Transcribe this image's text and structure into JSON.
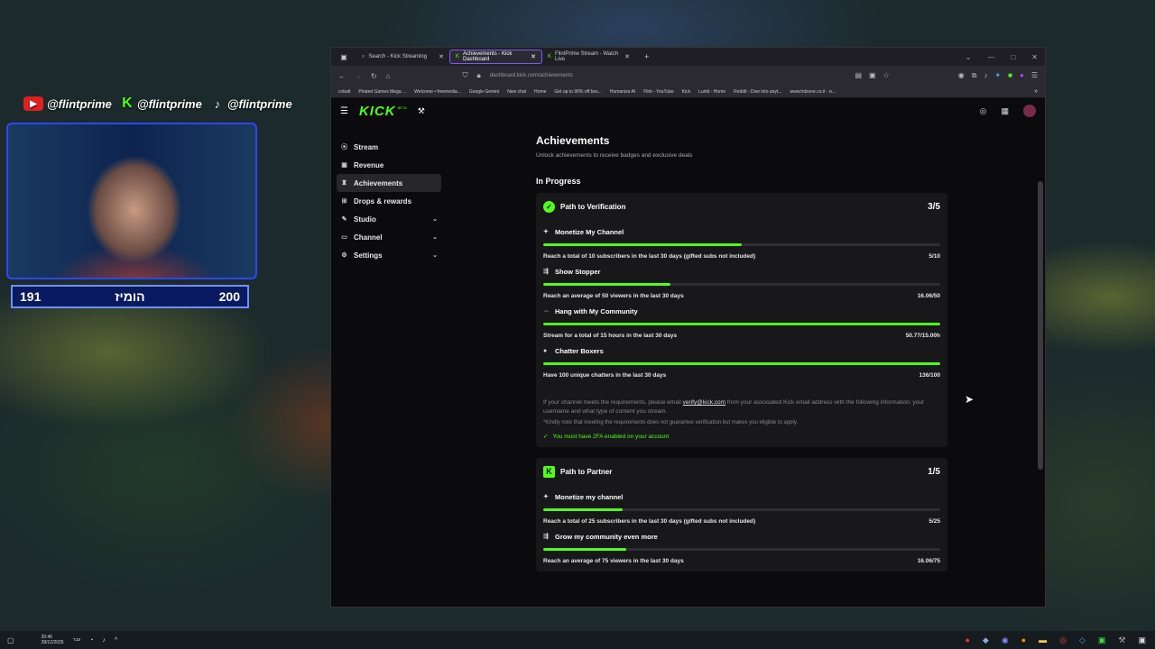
{
  "overlay": {
    "socials": [
      {
        "icon": "youtube-icon",
        "handle": "@flintprime"
      },
      {
        "icon": "kick-icon",
        "handle": "@flintprime"
      },
      {
        "icon": "tiktok-icon",
        "handle": "@flintprime"
      }
    ],
    "counter": {
      "left": "191",
      "middle": "הומיז",
      "right": "200"
    }
  },
  "browser": {
    "tabs": [
      {
        "title": "Search - Kick Streaming",
        "active": false
      },
      {
        "title": "Achievements - Kick Dashboard",
        "active": true
      },
      {
        "title": "FlintPrime Stream - Watch Live",
        "active": false
      }
    ],
    "url": "dashboard.kick.com/achievements",
    "bookmarks": [
      "cobalt",
      "Pirated Games Mega ...",
      "Welcome • freemedia...",
      "Google Gemini",
      "New chat",
      "Home",
      "Get up to 90% off bes...",
      "Humanize AI",
      "Flint - YouTube",
      "Kick",
      "Lurkit - Home",
      "Reddit - Dive into anyt...",
      "www.hdzone.co.il - ס..."
    ]
  },
  "app": {
    "logo": "KICK",
    "beta": "BETA",
    "sidebar": [
      {
        "label": "Stream",
        "icon": "broadcast-icon",
        "active": false,
        "chevron": false
      },
      {
        "label": "Revenue",
        "icon": "revenue-icon",
        "active": false,
        "chevron": false
      },
      {
        "label": "Achievements",
        "icon": "trophy-icon",
        "active": true,
        "chevron": false
      },
      {
        "label": "Drops & rewards",
        "icon": "gift-icon",
        "active": false,
        "chevron": false
      },
      {
        "label": "Studio",
        "icon": "studio-icon",
        "active": false,
        "chevron": true
      },
      {
        "label": "Channel",
        "icon": "channel-icon",
        "active": false,
        "chevron": true
      },
      {
        "label": "Settings",
        "icon": "gear-icon",
        "active": false,
        "chevron": true
      }
    ],
    "page_title": "Achievements",
    "page_subtitle": "Unlock achievements to receive badges and exclusive deals",
    "section_title": "In Progress",
    "verification": {
      "title": "Path to Verification",
      "score": "3/5",
      "items": [
        {
          "name": "Monetize My Channel",
          "icon": "sparkle-icon",
          "desc": "Reach a total of 10 subscribers in the last 30 days (gifted subs not included)",
          "value": "5/10",
          "progress": 0.5
        },
        {
          "name": "Show Stopper",
          "icon": "viewers-icon",
          "desc": "Reach an average of 50 viewers in the last 30 days",
          "value": "16.06/50",
          "progress": 0.32
        },
        {
          "name": "Hang with My Community",
          "icon": "community-icon",
          "desc": "Stream for a total of 15 hours in the last 30 days",
          "value": "50.77/15.00h",
          "progress": 1.0
        },
        {
          "name": "Chatter Boxers",
          "icon": "chat-icon",
          "desc": "Have 100 unique chatters in the last 30 days",
          "value": "136/100",
          "progress": 1.0
        }
      ],
      "note_prefix": "If your channel meets the requirements, please email ",
      "note_email": "verify@kick.com",
      "note_suffix": " from your associated Kick email address with the following information: your username and what type of content you stream.",
      "note2": "*Kindly note that meeting the requirements does not guarantee verification but makes you eligible to apply.",
      "twofa": "You must have 2FA enabled on your account"
    },
    "partner": {
      "title": "Path to Partner",
      "score": "1/5",
      "items": [
        {
          "name": "Monetize my channel",
          "icon": "sparkle-icon",
          "desc": "Reach a total of 25 subscribers in the last 30 days (gifted subs not included)",
          "value": "5/25",
          "progress": 0.2
        },
        {
          "name": "Grow my community even more",
          "icon": "viewers-icon",
          "desc": "Reach an average of 75 viewers in the last 30 days",
          "value": "16.06/75",
          "progress": 0.21
        }
      ]
    }
  },
  "taskbar": {
    "time": "20:46",
    "date": "28/12/2025",
    "lang": "עבר"
  },
  "colors": {
    "accent": "#53fc18",
    "panel": "#18181b",
    "bg": "#0b0b0d"
  }
}
